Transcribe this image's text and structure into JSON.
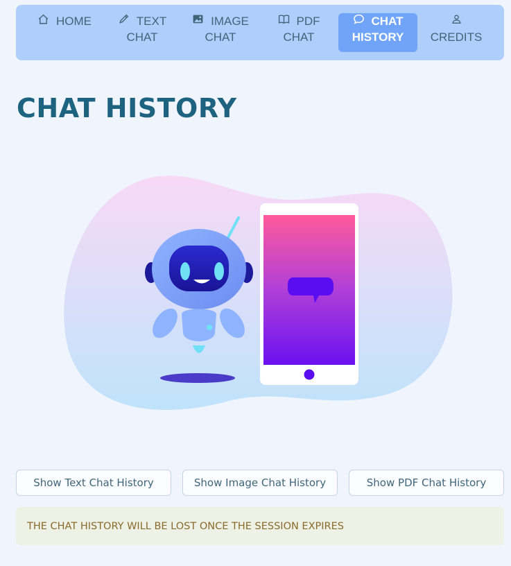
{
  "nav": {
    "items": [
      {
        "line1": "HOME",
        "line2": "",
        "icon": "home-icon"
      },
      {
        "line1": "TEXT",
        "line2": "CHAT",
        "icon": "pencil-icon"
      },
      {
        "line1": "IMAGE",
        "line2": "CHAT",
        "icon": "image-icon"
      },
      {
        "line1": "PDF",
        "line2": "CHAT",
        "icon": "book-icon"
      },
      {
        "line1": "CHAT",
        "line2": "HISTORY",
        "icon": "chat-bubble-icon"
      },
      {
        "line1": "",
        "line2": "CREDITS",
        "icon": "user-icon"
      }
    ],
    "active_index": 4
  },
  "page": {
    "title": "CHAT HISTORY"
  },
  "buttons": {
    "text_history": "Show Text Chat History",
    "image_history": "Show Image Chat History",
    "pdf_history": "Show PDF Chat History"
  },
  "notice": {
    "text": "THE CHAT HISTORY WILL BE LOST ONCE THE SESSION EXPIRES"
  },
  "colors": {
    "nav_bg": "#aecffc",
    "nav_active": "#6fa4f8",
    "title": "#1d6380",
    "page_bg": "#eff4fd"
  }
}
